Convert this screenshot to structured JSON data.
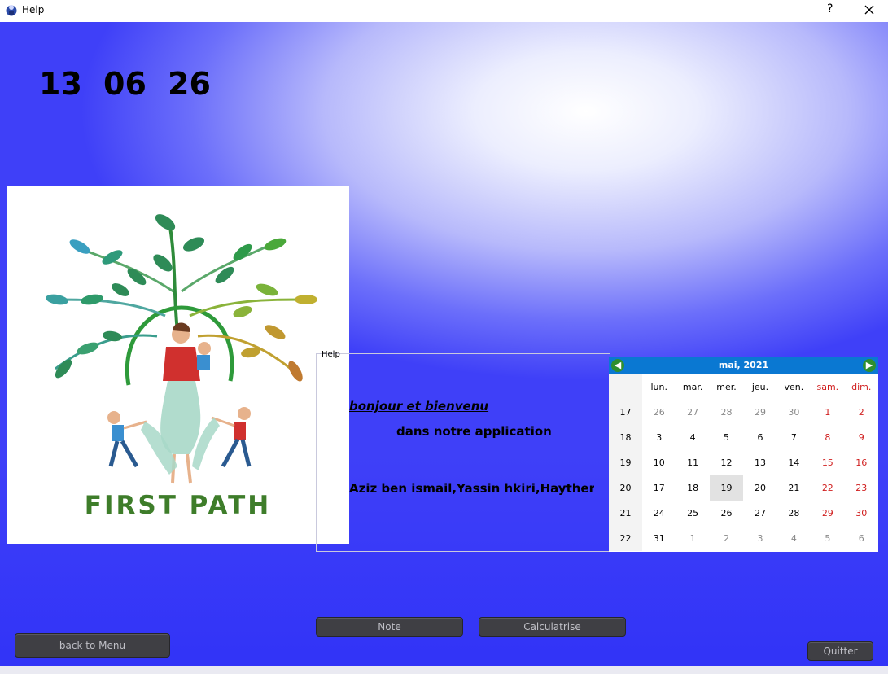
{
  "window": {
    "title": "Help",
    "help_glyph": "?",
    "icons": [
      "app-icon",
      "close-icon"
    ]
  },
  "clock": {
    "hours": "13",
    "minutes": "06",
    "seconds": "26"
  },
  "logo": {
    "caption": "FIRST PATH"
  },
  "helpbox": {
    "title": "Help",
    "welcome": "bonjour et bienvenu",
    "app_line": "dans notre application",
    "authors": "Aziz ben ismail,Yassin hkiri,Haythem"
  },
  "calendar": {
    "month_label": "mai,  2021",
    "prev_icon": "arrow-left-icon",
    "next_icon": "arrow-right-icon",
    "day_headers": [
      "lun.",
      "mar.",
      "mer.",
      "jeu.",
      "ven.",
      "sam.",
      "dim."
    ],
    "weeks": [
      {
        "week": "17",
        "days": [
          "26",
          "27",
          "28",
          "29",
          "30",
          "1",
          "2"
        ]
      },
      {
        "week": "18",
        "days": [
          "3",
          "4",
          "5",
          "6",
          "7",
          "8",
          "9"
        ]
      },
      {
        "week": "19",
        "days": [
          "10",
          "11",
          "12",
          "13",
          "14",
          "15",
          "16"
        ]
      },
      {
        "week": "20",
        "days": [
          "17",
          "18",
          "19",
          "20",
          "21",
          "22",
          "23"
        ]
      },
      {
        "week": "21",
        "days": [
          "24",
          "25",
          "26",
          "27",
          "28",
          "29",
          "30"
        ]
      },
      {
        "week": "22",
        "days": [
          "31",
          "1",
          "2",
          "3",
          "4",
          "5",
          "6"
        ]
      }
    ],
    "selected_day": "19",
    "colors": {
      "nav": "#0a78d2",
      "weekend": "#d01e1e",
      "other_month": "#8a8a8a"
    }
  },
  "buttons": {
    "note": "Note",
    "calculatrise": "Calculatrise",
    "back": "back to Menu",
    "quit": "Quitter"
  },
  "colors": {
    "background": "#3a3cf7",
    "button": "#3f3f44"
  }
}
